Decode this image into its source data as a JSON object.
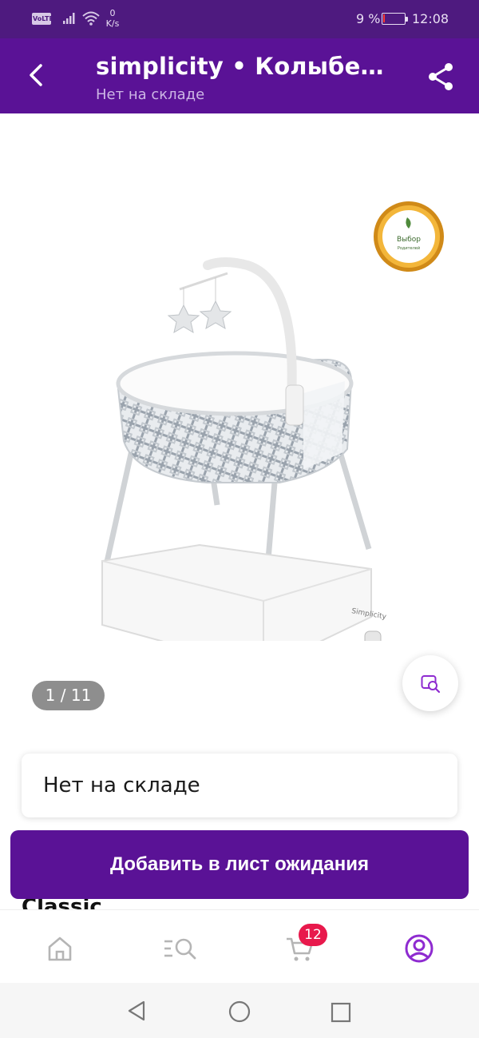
{
  "status_bar": {
    "network_badge": "VoLTE",
    "speed_value": "0",
    "speed_unit": "K/s",
    "battery_percent": "9 %",
    "battery_level": 0.09,
    "time": "12:08"
  },
  "app_bar": {
    "title": "simplicity • Колыбель Classic",
    "subtitle": "Нет на складе",
    "back_icon": "chevron-left-icon",
    "share_icon": "share-icon"
  },
  "gallery": {
    "image_subject": "bassinet crib product photo",
    "image_brand_mark": "Simplicity",
    "badge_text_line1": "Выбор",
    "badge_text_line2": "Родителей",
    "counter": "1 / 11",
    "visual_search_icon": "image-search-icon"
  },
  "stock": {
    "status": "Нет на складе"
  },
  "peek_text": "Classic",
  "actions": {
    "waitlist_button": "Добавить в лист ожидания"
  },
  "bottom_nav": {
    "items": [
      {
        "icon": "home-icon",
        "active": false
      },
      {
        "icon": "catalog-search-icon",
        "active": false
      },
      {
        "icon": "cart-icon",
        "active": false
      },
      {
        "icon": "profile-icon",
        "active": true
      }
    ],
    "cart_count": "12",
    "active_color": "#8e2bd0",
    "inactive_color": "#b5b5b5",
    "badge_color": "#e8194c"
  },
  "colors": {
    "brand": "#5a1296",
    "status_bar": "#4e1a7f"
  }
}
